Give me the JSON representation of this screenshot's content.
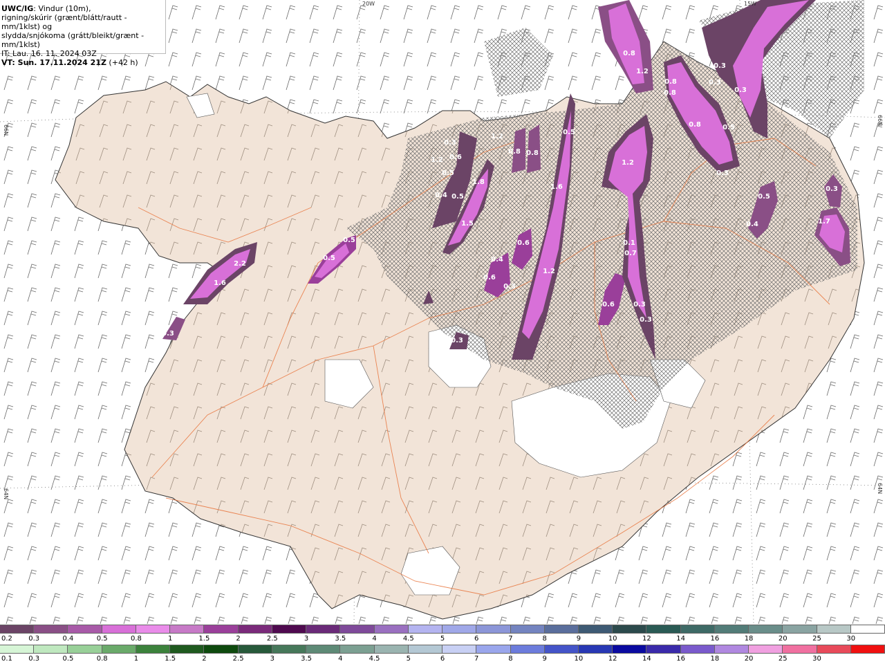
{
  "info": {
    "line1_bold": "UWC/IG",
    "line1_rest": ": Vindur (10m),",
    "line2": "rigning/skúrir (grænt/blátt/rautt - mm/1klst) og",
    "line3": "slydda/snjókoma (grátt/bleikt/grænt - mm/1klst)",
    "line4": "IT: Lau. 16. 11. 2024 03Z",
    "line5_bold": "VT: Sun. 17.11.2024 21Z",
    "line5_rest": " (+42 h)"
  },
  "axes": {
    "lon_top_1": "20W",
    "lon_top_2": "15W",
    "lat_left_1": "66N",
    "lat_left_2": "64N",
    "lat_right_1": "66N",
    "lat_right_2": "64N"
  },
  "precip_labels": [
    {
      "text": "2.2"
    },
    {
      "text": "1.6"
    },
    {
      "text": "0.3"
    },
    {
      "text": "0.5"
    },
    {
      "text": "0.5"
    },
    {
      "text": "0.3"
    },
    {
      "text": "0.6"
    },
    {
      "text": "1.2"
    },
    {
      "text": "0.5"
    },
    {
      "text": "0.4"
    },
    {
      "text": "0.5"
    },
    {
      "text": "1.8"
    },
    {
      "text": "1.5"
    },
    {
      "text": "0.8"
    },
    {
      "text": "0.8"
    },
    {
      "text": "1.2"
    },
    {
      "text": "0.5"
    },
    {
      "text": "1.6"
    },
    {
      "text": "1.2"
    },
    {
      "text": "0.6"
    },
    {
      "text": "0.4"
    },
    {
      "text": "0.6"
    },
    {
      "text": "0.3"
    },
    {
      "text": "0.3"
    },
    {
      "text": "1.2"
    },
    {
      "text": "0.1"
    },
    {
      "text": "0.7"
    },
    {
      "text": "0.6"
    },
    {
      "text": "0.3"
    },
    {
      "text": "0.3"
    },
    {
      "text": "0.8"
    },
    {
      "text": "1.2"
    },
    {
      "text": "0.8"
    },
    {
      "text": "0.8"
    },
    {
      "text": "0.8"
    },
    {
      "text": "0.5"
    },
    {
      "text": "0.3"
    },
    {
      "text": "0.3"
    },
    {
      "text": "0.3"
    },
    {
      "text": "0.5"
    },
    {
      "text": "0.4"
    },
    {
      "text": "0.3"
    },
    {
      "text": "1.7"
    },
    {
      "text": "0.3"
    }
  ],
  "legend_snow": {
    "labels": [
      "0.2",
      "0.3",
      "0.4",
      "0.5",
      "0.8",
      "1",
      "1.5",
      "2",
      "2.5",
      "3",
      "3.5",
      "4",
      "4.5",
      "5",
      "6",
      "7",
      "8",
      "9",
      "10",
      "12",
      "14",
      "16",
      "18",
      "20",
      "25",
      "30"
    ],
    "colors": [
      "#6b4466",
      "#8a4f86",
      "#a85aa8",
      "#d870d8",
      "#e98ce9",
      "#c77ac7",
      "#9a3f9a",
      "#7a2a7a",
      "#4f0a4f",
      "#6a2a78",
      "#7f4a9a",
      "#9a70c0",
      "#b4b4f0",
      "#a0a8e8",
      "#8c96d8",
      "#7484c0",
      "#5a6e9c",
      "#3e5a74",
      "#2c4a4c",
      "#2a5a54",
      "#3e6a66",
      "#527c78",
      "#6a8e8a",
      "#8aa4a2",
      "#b8c8c6",
      "#ffffff"
    ]
  },
  "legend_rain": {
    "labels": [
      "0.1",
      "0.3",
      "0.5",
      "0.8",
      "1",
      "1.5",
      "2",
      "2.5",
      "3",
      "3.5",
      "4",
      "4.5",
      "5",
      "6",
      "7",
      "8",
      "9",
      "10",
      "12",
      "14",
      "16",
      "18",
      "20",
      "25",
      "30"
    ],
    "colors": [
      "#d6f5d6",
      "#bfe8bf",
      "#98d098",
      "#6aaa6a",
      "#3c823c",
      "#1f5a1f",
      "#0e4a0e",
      "#27593a",
      "#46785a",
      "#5e8a76",
      "#7ca092",
      "#9ab4b0",
      "#b4c8d4",
      "#c8d0f4",
      "#9aa6ec",
      "#6c7cdc",
      "#4454c8",
      "#2838b4",
      "#0a0aa0",
      "#3a2aaa",
      "#7a5acc",
      "#b088e0",
      "#f0a0e0",
      "#f070a0",
      "#e84a5a",
      "#f01010"
    ]
  }
}
